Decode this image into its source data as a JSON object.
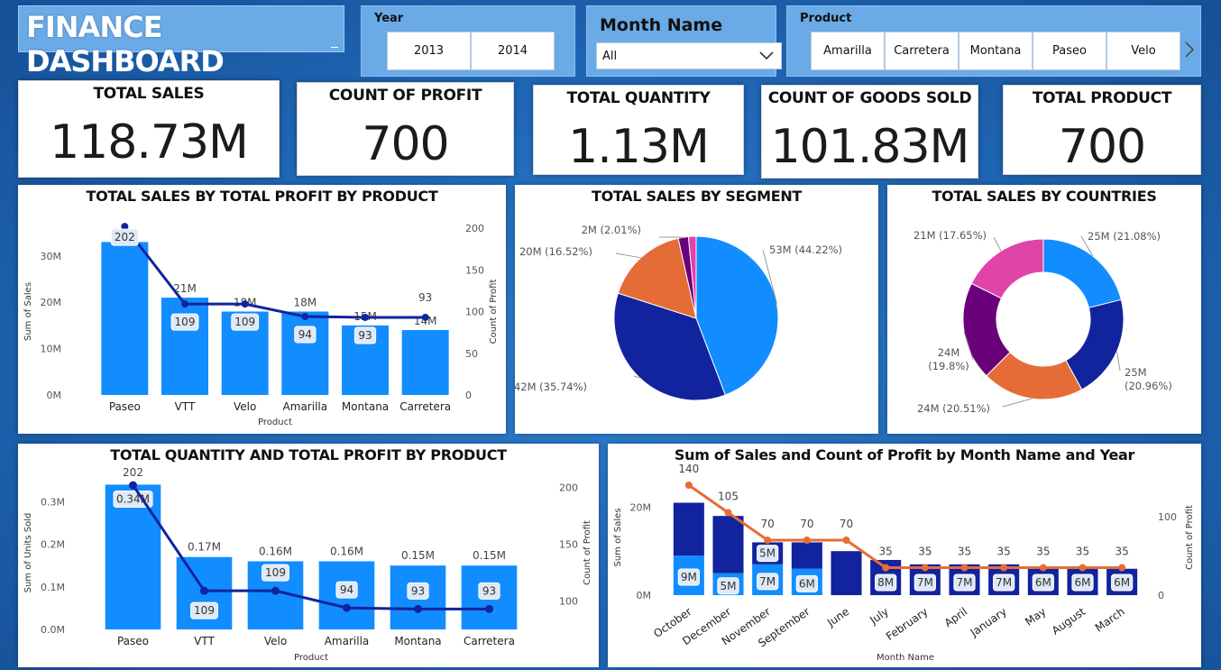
{
  "header": {
    "title": "FINANCE DASHBOARD"
  },
  "slicers": {
    "year": {
      "label": "Year",
      "options": [
        "2013",
        "2014"
      ]
    },
    "month": {
      "label": "Month Name",
      "selected": "All"
    },
    "product": {
      "label": "Product",
      "options": [
        "Amarilla",
        "Carretera",
        "Montana",
        "Paseo",
        "Velo"
      ]
    }
  },
  "cards": [
    {
      "label": "TOTAL SALES",
      "value": "118.73M"
    },
    {
      "label": "COUNT OF PROFIT",
      "value": "700"
    },
    {
      "label": "TOTAL QUANTITY",
      "value": "1.13M"
    },
    {
      "label": "COUNT OF GOODS SOLD",
      "value": "101.83M"
    },
    {
      "label": "TOTAL PRODUCT",
      "value": "700"
    }
  ],
  "colors": {
    "bar_blue": "#118dff",
    "navy": "#12239e",
    "orange": "#e66c37",
    "purple": "#6b007b",
    "pink": "#e044a7"
  },
  "chart_data": [
    {
      "type": "bar",
      "title": "TOTAL SALES BY TOTAL PROFIT BY PRODUCT",
      "xlabel": "Product",
      "ylabel": "Sum of Sales",
      "y2label": "Count of Profit",
      "categories": [
        "Paseo",
        "VTT",
        "Velo",
        "Amarilla",
        "Montana",
        "Carretera"
      ],
      "series": [
        {
          "name": "Sum of Sales",
          "values": [
            33,
            21,
            18,
            18,
            15,
            14
          ],
          "labels": [
            "33M",
            "21M",
            "18M",
            "18M",
            "15M",
            "14M"
          ]
        },
        {
          "name": "Count of Profit",
          "values": [
            202,
            109,
            109,
            94,
            93,
            93
          ]
        }
      ],
      "ylim": [
        0,
        36
      ],
      "yticks": [
        "0M",
        "10M",
        "20M",
        "30M"
      ],
      "y2lim": [
        0,
        200
      ],
      "y2ticks": [
        "0",
        "50",
        "100",
        "150",
        "200"
      ]
    },
    {
      "type": "pie",
      "title": "TOTAL SALES BY SEGMENT",
      "slices": [
        {
          "label": "53M (44.22%)",
          "value": 44.22,
          "color": "#118dff"
        },
        {
          "label": "42M (35.74%)",
          "value": 35.74,
          "color": "#12239e"
        },
        {
          "label": "20M (16.52%)",
          "value": 16.52,
          "color": "#e66c37"
        },
        {
          "label": "2M (2.01%)",
          "value": 2.01,
          "color": "#6b007b"
        },
        {
          "label": "",
          "value": 1.51,
          "color": "#e044a7"
        }
      ]
    },
    {
      "type": "pie",
      "title": "TOTAL SALES BY COUNTRIES",
      "donut": true,
      "slices": [
        {
          "label": "25M (21.08%)",
          "value": 21.08,
          "color": "#118dff"
        },
        {
          "label": "25M (20.96%)",
          "value": 20.96,
          "color": "#12239e"
        },
        {
          "label": "24M (20.51%)",
          "value": 20.51,
          "color": "#e66c37"
        },
        {
          "label": "24M (19.8%)",
          "value": 19.8,
          "color": "#6b007b"
        },
        {
          "label": "21M (17.65%)",
          "value": 17.65,
          "color": "#e044a7"
        }
      ]
    },
    {
      "type": "bar",
      "title": "TOTAL QUANTITY AND TOTAL PROFIT BY PRODUCT",
      "xlabel": "Product",
      "ylabel": "Sum of Units Sold",
      "y2label": "Count of Profit",
      "categories": [
        "Paseo",
        "VTT",
        "Velo",
        "Amarilla",
        "Montana",
        "Carretera"
      ],
      "series": [
        {
          "name": "Sum of Units Sold",
          "values": [
            0.34,
            0.17,
            0.16,
            0.16,
            0.15,
            0.15
          ],
          "labels": [
            "0.34M",
            "0.17M",
            "0.16M",
            "0.16M",
            "0.15M",
            "0.15M"
          ]
        },
        {
          "name": "Count of Profit",
          "values": [
            202,
            109,
            109,
            94,
            93,
            93
          ]
        }
      ],
      "ylim": [
        0,
        0.36
      ],
      "yticks": [
        "0.0M",
        "0.1M",
        "0.2M",
        "0.3M"
      ],
      "y2lim": [
        75,
        210
      ],
      "y2ticks": [
        "100",
        "150",
        "200"
      ]
    },
    {
      "type": "bar",
      "stacked": true,
      "title": "Sum of Sales and Count of Profit by Month Name and Year",
      "xlabel": "Month Name",
      "ylabel": "Sum of Sales",
      "y2label": "Count of Profit",
      "categories": [
        "October",
        "December",
        "November",
        "September",
        "June",
        "July",
        "February",
        "April",
        "January",
        "May",
        "August",
        "March"
      ],
      "series": [
        {
          "name": "2013",
          "values": [
            9,
            5,
            7,
            6,
            0,
            0,
            0,
            0,
            0,
            0,
            0,
            0
          ],
          "labels": [
            "9M",
            "5M",
            "7M",
            "6M",
            "",
            "",
            "",
            "",
            "",
            "",
            "",
            ""
          ]
        },
        {
          "name": "2014",
          "values": [
            12,
            13,
            5,
            6,
            10,
            8,
            7,
            7,
            7,
            6,
            6,
            6
          ],
          "labels": [
            "",
            "",
            "5M",
            "",
            "",
            "8M",
            "7M",
            "7M",
            "7M",
            "6M",
            "6M",
            "6M"
          ]
        },
        {
          "name": "Count of Profit",
          "values": [
            140,
            105,
            70,
            70,
            70,
            35,
            35,
            35,
            35,
            35,
            35,
            35
          ]
        }
      ],
      "ylim": [
        0,
        25
      ],
      "yticks": [
        "0M",
        "20M"
      ],
      "y2lim": [
        0,
        140
      ],
      "y2ticks": [
        "0",
        "100"
      ]
    }
  ]
}
